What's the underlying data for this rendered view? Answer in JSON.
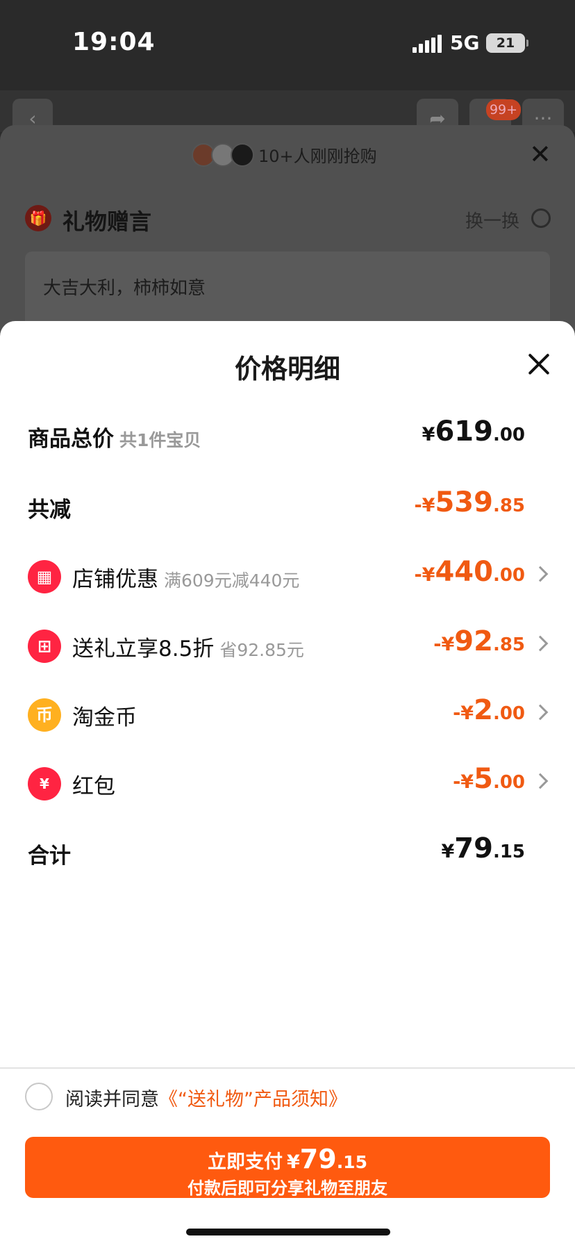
{
  "status_bar": {
    "time": "19:04",
    "network": "5G",
    "battery": "21"
  },
  "background": {
    "cart_badge": "99+",
    "buyers_notice": "10+人刚刚抢购",
    "gift_section_title": "礼物赠言",
    "swap_label": "换一换",
    "gift_message": "大吉大利，柿柿如意"
  },
  "panel": {
    "title": "价格明细",
    "total": {
      "label": "商品总价",
      "sub": "共1件宝贝",
      "currency": "¥",
      "int": "619",
      "dec": ".00"
    },
    "discount_total": {
      "label": "共减",
      "currency": "-¥",
      "int": "539",
      "dec": ".85"
    },
    "items": [
      {
        "icon": "store-icon",
        "label": "店铺优惠",
        "sub": "满609元减440元",
        "currency": "-¥",
        "int": "440",
        "dec": ".00",
        "icon_color": "#ff2442"
      },
      {
        "icon": "gift-icon",
        "label": "送礼立享8.5折",
        "sub": "省92.85元",
        "currency": "-¥",
        "int": "92",
        "dec": ".85",
        "icon_color": "#ff2442"
      },
      {
        "icon": "coin-icon",
        "label": "淘金币",
        "sub": "",
        "currency": "-¥",
        "int": "2",
        "dec": ".00",
        "icon_color": "#ffb020"
      },
      {
        "icon": "red-packet-icon",
        "label": "红包",
        "sub": "",
        "currency": "-¥",
        "int": "5",
        "dec": ".00",
        "icon_color": "#ff2442"
      }
    ],
    "sum": {
      "label": "合计",
      "currency": "¥",
      "int": "79",
      "dec": ".15"
    }
  },
  "agreement": {
    "text": "阅读并同意",
    "link": "《“送礼物”产品须知》"
  },
  "pay_button": {
    "label": "立即支付",
    "currency": "¥",
    "int": "79",
    "dec": ".15",
    "subtitle": "付款后即可分享礼物至朋友"
  },
  "colors": {
    "accent": "#ff5a0f",
    "discount": "#f05a12"
  }
}
